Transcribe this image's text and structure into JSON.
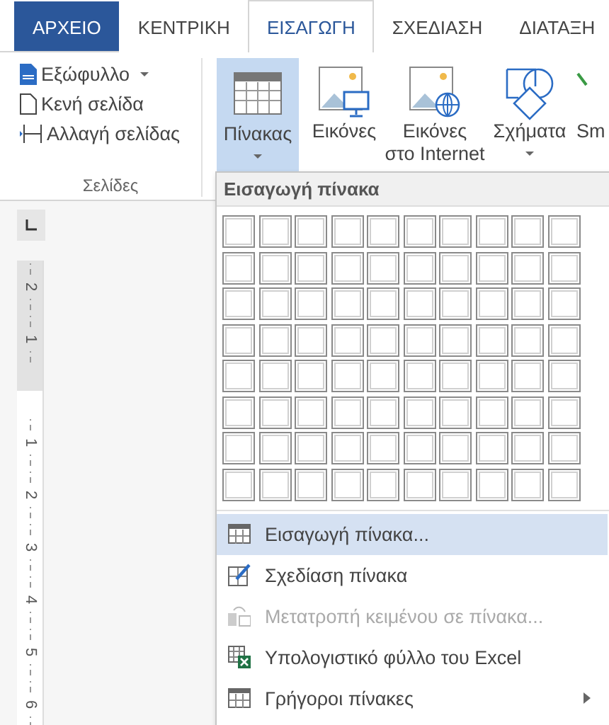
{
  "tabs": [
    {
      "label": "ΑΡΧΕΙΟ",
      "kind": "file",
      "selected": false
    },
    {
      "label": "ΚΕΝΤΡΙΚΗ",
      "kind": "tab",
      "selected": false
    },
    {
      "label": "ΕΙΣΑΓΩΓΗ",
      "kind": "tab",
      "selected": true
    },
    {
      "label": "ΣΧΕΔΙΑΣΗ",
      "kind": "tab",
      "selected": false
    },
    {
      "label": "ΔΙΑΤΑΞΗ",
      "kind": "tab",
      "selected": false
    }
  ],
  "pages_group": {
    "label": "Σελίδες",
    "items": [
      {
        "label": "Εξώφυλλο",
        "kind": "cover",
        "dropdown": true
      },
      {
        "label": "Κενή σελίδα",
        "kind": "blank",
        "dropdown": false
      },
      {
        "label": "Αλλαγή σελίδας",
        "kind": "break",
        "dropdown": false
      }
    ]
  },
  "ribbon_buttons": [
    {
      "kind": "table",
      "lines": [
        "Πίνακας"
      ],
      "dropdown": true,
      "selected": true
    },
    {
      "kind": "pictures",
      "lines": [
        "Εικόνες"
      ],
      "dropdown": false,
      "selected": false
    },
    {
      "kind": "online",
      "lines": [
        "Εικόνες",
        "στο Internet"
      ],
      "dropdown": false,
      "selected": false
    },
    {
      "kind": "shapes",
      "lines": [
        "Σχήματα"
      ],
      "dropdown": true,
      "selected": false
    },
    {
      "kind": "cut",
      "lines": [
        "Sm"
      ],
      "dropdown": false,
      "selected": false
    }
  ],
  "ruler": [
    {
      "label": "2",
      "shaded": true
    },
    {
      "label": "1",
      "shaded": true
    },
    {
      "label": "1",
      "shaded": false
    },
    {
      "label": "2",
      "shaded": false
    },
    {
      "label": "3",
      "shaded": false
    },
    {
      "label": "4",
      "shaded": false
    },
    {
      "label": "5",
      "shaded": false
    },
    {
      "label": "6",
      "shaded": false
    }
  ],
  "dropdown": {
    "title": "Εισαγωγή πίνακα",
    "cell_grid": [
      [
        {
          "selected": false
        },
        {
          "selected": false
        },
        {
          "selected": false
        },
        {
          "selected": false
        },
        {
          "selected": false
        },
        {
          "selected": false
        },
        {
          "selected": false
        },
        {
          "selected": false
        },
        {
          "selected": false
        },
        {
          "selected": false
        }
      ],
      [
        {
          "selected": false
        },
        {
          "selected": false
        },
        {
          "selected": false
        },
        {
          "selected": false
        },
        {
          "selected": false
        },
        {
          "selected": false
        },
        {
          "selected": false
        },
        {
          "selected": false
        },
        {
          "selected": false
        },
        {
          "selected": false
        }
      ],
      [
        {
          "selected": false
        },
        {
          "selected": false
        },
        {
          "selected": false
        },
        {
          "selected": false
        },
        {
          "selected": false
        },
        {
          "selected": false
        },
        {
          "selected": false
        },
        {
          "selected": false
        },
        {
          "selected": false
        },
        {
          "selected": false
        }
      ],
      [
        {
          "selected": false
        },
        {
          "selected": false
        },
        {
          "selected": false
        },
        {
          "selected": false
        },
        {
          "selected": false
        },
        {
          "selected": false
        },
        {
          "selected": false
        },
        {
          "selected": false
        },
        {
          "selected": false
        },
        {
          "selected": false
        }
      ],
      [
        {
          "selected": false
        },
        {
          "selected": false
        },
        {
          "selected": false
        },
        {
          "selected": false
        },
        {
          "selected": false
        },
        {
          "selected": false
        },
        {
          "selected": false
        },
        {
          "selected": false
        },
        {
          "selected": false
        },
        {
          "selected": false
        }
      ],
      [
        {
          "selected": false
        },
        {
          "selected": false
        },
        {
          "selected": false
        },
        {
          "selected": false
        },
        {
          "selected": false
        },
        {
          "selected": false
        },
        {
          "selected": false
        },
        {
          "selected": false
        },
        {
          "selected": false
        },
        {
          "selected": false
        }
      ],
      [
        {
          "selected": false
        },
        {
          "selected": false
        },
        {
          "selected": false
        },
        {
          "selected": false
        },
        {
          "selected": false
        },
        {
          "selected": false
        },
        {
          "selected": false
        },
        {
          "selected": false
        },
        {
          "selected": false
        },
        {
          "selected": false
        }
      ],
      [
        {
          "selected": false
        },
        {
          "selected": false
        },
        {
          "selected": false
        },
        {
          "selected": false
        },
        {
          "selected": false
        },
        {
          "selected": false
        },
        {
          "selected": false
        },
        {
          "selected": false
        },
        {
          "selected": false
        },
        {
          "selected": false
        }
      ]
    ],
    "items": [
      {
        "label": "Εισαγωγή πίνακα...",
        "kind": "insert",
        "selected": true,
        "disabled": false,
        "submenu": false
      },
      {
        "label": "Σχεδίαση πίνακα",
        "kind": "draw",
        "selected": false,
        "disabled": false,
        "submenu": false
      },
      {
        "label": "Μετατροπή κειμένου σε πίνακα...",
        "kind": "convert",
        "selected": false,
        "disabled": true,
        "submenu": false
      },
      {
        "label": "Υπολογιστικό φύλλο του Excel",
        "kind": "excel",
        "selected": false,
        "disabled": false,
        "submenu": false
      },
      {
        "label": "Γρήγοροι πίνακες",
        "kind": "quick",
        "selected": false,
        "disabled": false,
        "submenu": true
      }
    ]
  }
}
